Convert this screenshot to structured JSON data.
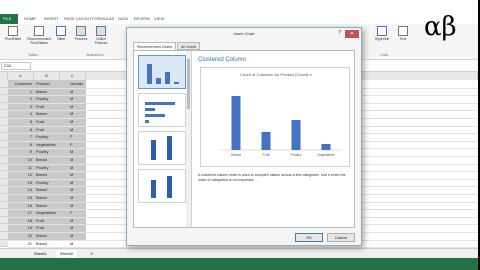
{
  "ribbon": {
    "tabs": [
      "FILE",
      "HOME",
      "INSERT",
      "PAGE LAYOUT",
      "FORMULAS",
      "DATA",
      "REVIEW",
      "VIEW"
    ],
    "buttons": [
      "PivotTable",
      "Recommended PivotTables",
      "Table",
      "Pictures",
      "Online Pictures",
      "Hyperlink",
      "Text"
    ],
    "groups": [
      "Tables",
      "Illustrations",
      "Links"
    ]
  },
  "namebox": "C11",
  "columns": [
    "A",
    "B",
    "C"
  ],
  "header_row": {
    "a": "Customer",
    "b": "Product",
    "c": "Gender"
  },
  "rows": [
    {
      "a": "1",
      "b": "Bread",
      "c": "M"
    },
    {
      "a": "2",
      "b": "Poultry",
      "c": "M"
    },
    {
      "a": "3",
      "b": "Fruit",
      "c": "M"
    },
    {
      "a": "4",
      "b": "Bread",
      "c": "M"
    },
    {
      "a": "5",
      "b": "Fruit",
      "c": "M"
    },
    {
      "a": "6",
      "b": "Fruit",
      "c": "M"
    },
    {
      "a": "7",
      "b": "Poultry",
      "c": "F"
    },
    {
      "a": "8",
      "b": "Vegetables",
      "c": "F"
    },
    {
      "a": "9",
      "b": "Poultry",
      "c": "M"
    },
    {
      "a": "10",
      "b": "Bread",
      "c": "M"
    },
    {
      "a": "11",
      "b": "Poultry",
      "c": "M"
    },
    {
      "a": "12",
      "b": "Bread",
      "c": "M"
    },
    {
      "a": "13",
      "b": "Poultry",
      "c": "M"
    },
    {
      "a": "14",
      "b": "Bread",
      "c": "M"
    },
    {
      "a": "15",
      "b": "Bread",
      "c": "M"
    },
    {
      "a": "16",
      "b": "Bread",
      "c": "M"
    },
    {
      "a": "17",
      "b": "Vegetables",
      "c": "F"
    },
    {
      "a": "18",
      "b": "Fruit",
      "c": "M"
    },
    {
      "a": "19",
      "b": "Fruit",
      "c": "M"
    },
    {
      "a": "20",
      "b": "Bread",
      "c": "M"
    },
    {
      "a": "21",
      "b": "Bread",
      "c": "M"
    }
  ],
  "sheets": [
    "Sheet1",
    "Sheet2"
  ],
  "dialog": {
    "title": "Insert Chart",
    "help": "?",
    "close": "✕",
    "tab_recommended": "Recommended Charts",
    "tab_all": "All Charts",
    "chart_type_title": "Clustered Column",
    "preview_title": "Count of Customer by Product (Count) e",
    "description": "A clustered column chart is used to compare values across a few categories. Use it when the order of categories is not important.",
    "ok": "OK",
    "cancel": "Cancel"
  },
  "chart_data": {
    "type": "bar",
    "title": "Count of Customer by Product (Count) e",
    "categories": [
      "Bread",
      "Fruit",
      "Poultry",
      "Vegetables"
    ],
    "values": [
      9,
      3,
      5,
      1
    ]
  },
  "logo_text": "αβ"
}
